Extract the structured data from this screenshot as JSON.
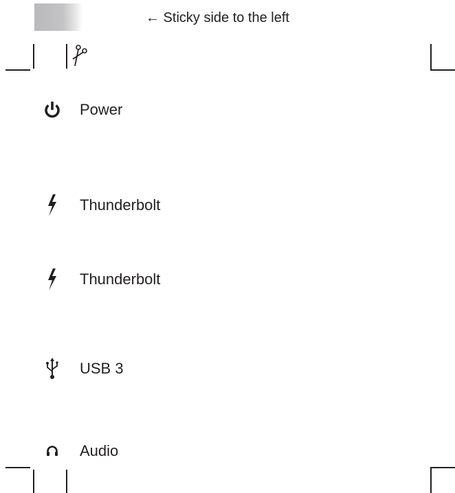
{
  "header": {
    "sticky_note": "← Sticky side to the left",
    "swatch_icon": "sticky-swatch"
  },
  "tools": {
    "cut_line_icon": "scissors-icon"
  },
  "ports": [
    {
      "icon": "power-icon",
      "label": "Power"
    },
    {
      "icon": "thunderbolt-icon",
      "label": "Thunderbolt"
    },
    {
      "icon": "thunderbolt-icon",
      "label": "Thunderbolt"
    },
    {
      "icon": "usb-icon",
      "label": "USB 3"
    },
    {
      "icon": "headphones-icon",
      "label": "Audio"
    }
  ],
  "colors": {
    "ink": "#231f20",
    "swatch": "#c4c4c6"
  }
}
